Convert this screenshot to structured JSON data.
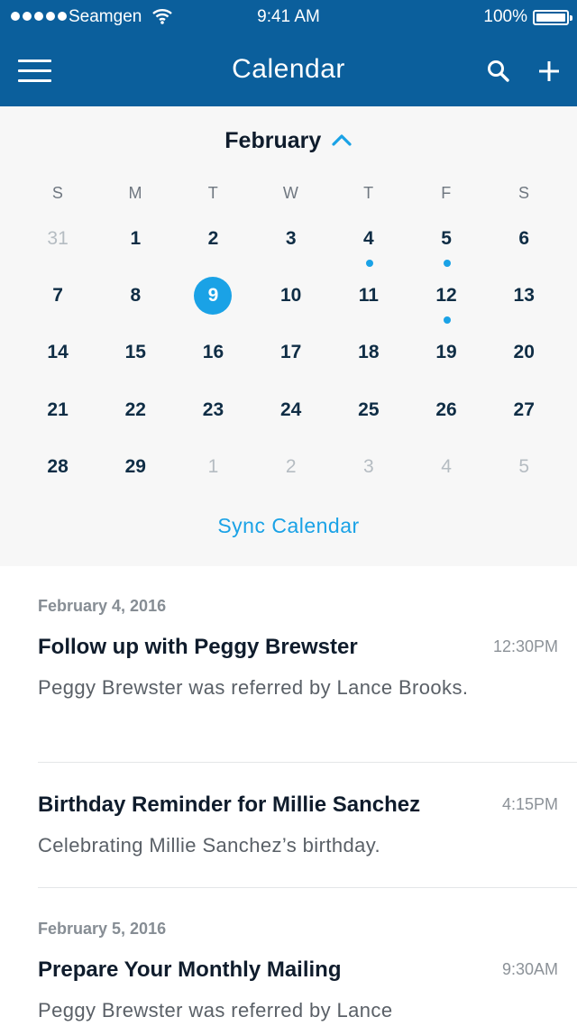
{
  "status_bar": {
    "carrier": "Seamgen",
    "time": "9:41 AM",
    "battery": "100%"
  },
  "header": {
    "title": "Calendar",
    "icons": [
      "hamburger-menu-icon",
      "search-icon",
      "plus-icon"
    ]
  },
  "calendar": {
    "month": "February",
    "weekdays": [
      "S",
      "M",
      "T",
      "W",
      "T",
      "F",
      "S"
    ],
    "days": [
      {
        "n": "31",
        "muted": true
      },
      {
        "n": "1"
      },
      {
        "n": "2"
      },
      {
        "n": "3"
      },
      {
        "n": "4",
        "dot": true
      },
      {
        "n": "5",
        "dot": true
      },
      {
        "n": "6"
      },
      {
        "n": "7"
      },
      {
        "n": "8"
      },
      {
        "n": "9",
        "selected": true
      },
      {
        "n": "10"
      },
      {
        "n": "11"
      },
      {
        "n": "12",
        "dot": true
      },
      {
        "n": "13"
      },
      {
        "n": "14"
      },
      {
        "n": "15"
      },
      {
        "n": "16"
      },
      {
        "n": "17"
      },
      {
        "n": "18"
      },
      {
        "n": "19"
      },
      {
        "n": "20"
      },
      {
        "n": "21"
      },
      {
        "n": "22"
      },
      {
        "n": "23"
      },
      {
        "n": "24"
      },
      {
        "n": "25"
      },
      {
        "n": "26"
      },
      {
        "n": "27"
      },
      {
        "n": "28"
      },
      {
        "n": "29"
      },
      {
        "n": "1",
        "muted": true
      },
      {
        "n": "2",
        "muted": true
      },
      {
        "n": "3",
        "muted": true
      },
      {
        "n": "4",
        "muted": true
      },
      {
        "n": "5",
        "muted": true
      }
    ],
    "sync_label": "Sync Calendar"
  },
  "events": {
    "date_1": "February 4, 2016",
    "date_2": "February 5, 2016",
    "items": [
      {
        "title": "Follow up with Peggy Brewster",
        "time": "12:30PM",
        "description": "Peggy Brewster was referred by Lance Brooks."
      },
      {
        "title": "Birthday Reminder for Millie Sanchez",
        "time": "4:15PM",
        "description": "Celebrating Millie Sanchez’s birthday."
      },
      {
        "title": "Prepare Your Monthly Mailing",
        "time": "9:30AM",
        "description": "Peggy Brewster was referred by Lance"
      }
    ]
  },
  "colors": {
    "header_bg": "#0b5f9c",
    "accent": "#1aa2e6",
    "calendar_bg": "#f7f7f7"
  }
}
